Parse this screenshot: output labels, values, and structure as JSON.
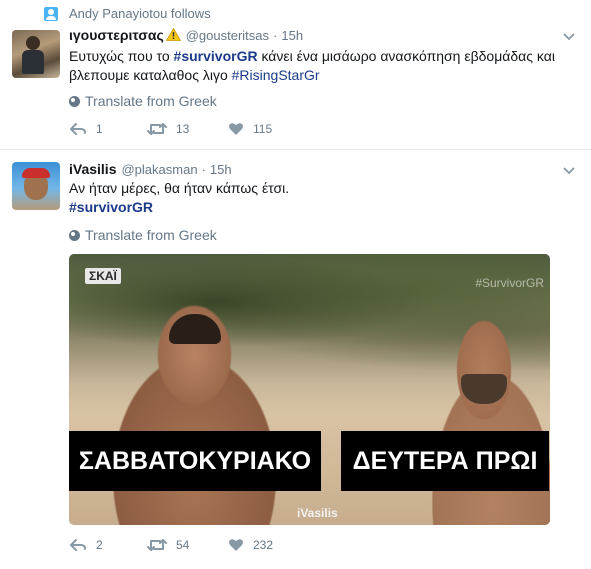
{
  "tweets": [
    {
      "context": "Andy Panayiotou follows",
      "name": "ιγουστεριτσας",
      "handle": "@gousteritsas",
      "time": "15h",
      "text_parts": [
        "Ευτυχώς που το ",
        "#survivorGR",
        " κάνει ένα μισάωρο ανασκόπηση εβδομάδας και βλεπουμε καταλαθος λιγο ",
        "#RisingStarGr"
      ],
      "translate": "Translate from Greek",
      "replies": "1",
      "retweets": "13",
      "likes": "115"
    },
    {
      "name": "iVasilis",
      "handle": "@plakasman",
      "time": "15h",
      "text_line": "Αν ήταν μέρες, θα ήταν κάπως έτσι.",
      "hashtag": "#survivorGR",
      "translate": "Translate from Greek",
      "media": {
        "channel_logo": "ΣΚΑΪ",
        "watermark_top": "#SurvivorGR",
        "caption_left": "ΣΑΒΒΑΤΟΚΥΡΙΑΚΟ",
        "caption_right": "ΔΕΥΤΕΡΑ ΠΡΩΙ",
        "watermark_bottom": "iVasilis"
      },
      "replies": "2",
      "retweets": "54",
      "likes": "232"
    }
  ],
  "separator": "·",
  "colors": {
    "link": "#1b3a8a",
    "muted": "#657786",
    "accent": "#4ab3f4",
    "warning": "#f5c518"
  },
  "icons": [
    "person-icon",
    "warning-icon",
    "chevron-down-icon",
    "globe-icon",
    "reply-icon",
    "retweet-icon",
    "heart-icon"
  ]
}
